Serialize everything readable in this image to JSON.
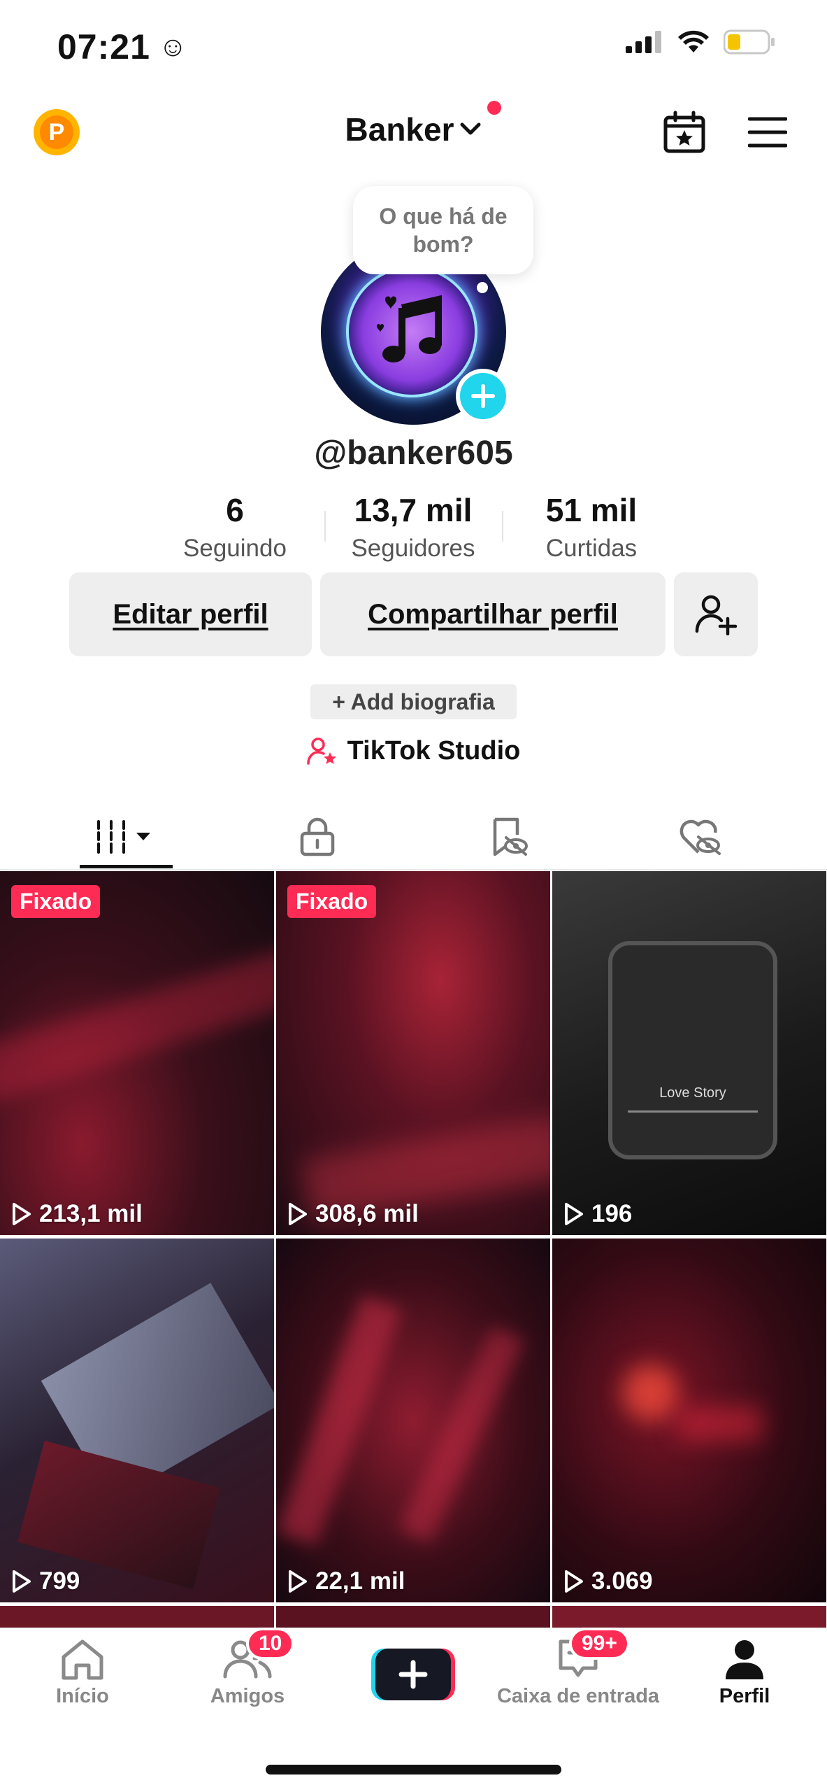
{
  "status_bar": {
    "time": "07:21",
    "emoji": "☺"
  },
  "header": {
    "points_badge": "P",
    "account_name": "Banker"
  },
  "profile": {
    "bubble_text": "O que há de bom?",
    "handle": "@banker605",
    "stats": [
      {
        "value": "6",
        "label": "Seguindo"
      },
      {
        "value": "13,7 mil",
        "label": "Seguidores"
      },
      {
        "value": "51 mil",
        "label": "Curtidas"
      }
    ],
    "edit_button": "Editar perfil",
    "share_button": "Compartilhar perfil",
    "add_bio": "+ Add biografia",
    "studio_label": "TikTok Studio"
  },
  "grid": [
    {
      "pinned": "Fixado",
      "views": "213,1 mil"
    },
    {
      "pinned": "Fixado",
      "views": "308,6 mil"
    },
    {
      "pinned": "",
      "views": "196",
      "song_title": "Love Story"
    },
    {
      "pinned": "",
      "views": "799"
    },
    {
      "pinned": "",
      "views": "22,1 mil"
    },
    {
      "pinned": "",
      "views": "3.069"
    }
  ],
  "bottom_nav": {
    "items": [
      {
        "label": "Início"
      },
      {
        "label": "Amigos",
        "badge": "10"
      },
      {
        "label": ""
      },
      {
        "label": "Caixa de entrada",
        "badge": "99+"
      },
      {
        "label": "Perfil"
      }
    ]
  },
  "colors": {
    "accent": "#fe2c55",
    "cyan": "#20d5ec",
    "pinned_bg": "#fe2c55"
  }
}
